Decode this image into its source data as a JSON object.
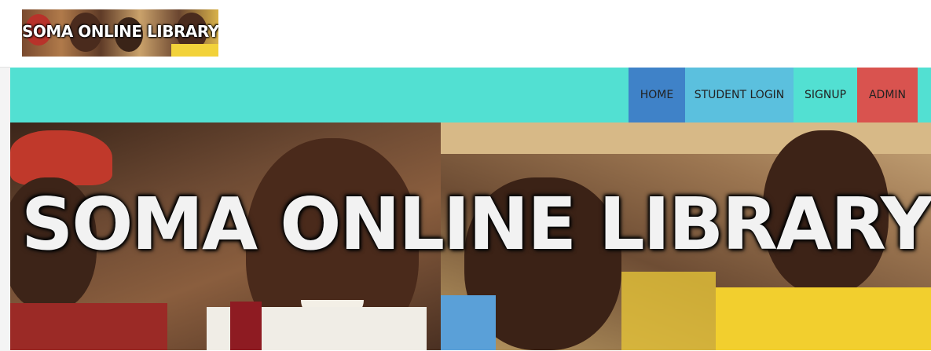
{
  "header": {
    "logo_text": "SOMA ONLINE LIBRARY"
  },
  "nav": {
    "items": [
      {
        "label": "HOME",
        "color": "#3f82c8"
      },
      {
        "label": "STUDENT LOGIN",
        "color": "#5bc0de"
      },
      {
        "label": "SIGNUP",
        "color": "#52e0d2"
      },
      {
        "label": "ADMIN",
        "color": "#d9534f"
      }
    ],
    "bar_color": "#52e0d2"
  },
  "hero": {
    "title": "SOMA ONLINE LIBRARY"
  }
}
